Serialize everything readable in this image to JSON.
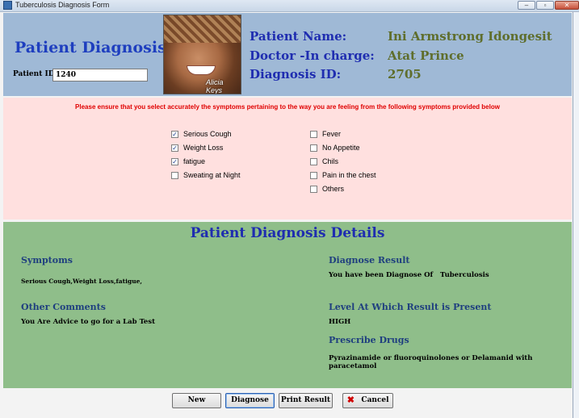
{
  "window": {
    "title": "Tuberculosis Diagnosis Form"
  },
  "header": {
    "title": "Patient Diagnosis",
    "patient_id_label": "Patient ID",
    "patient_id_value": "1240",
    "photo_caption": "Alicia Keys",
    "patient_name_label": "Patient Name:",
    "patient_name_value": "Ini Armstrong Idongesit",
    "doctor_label": "Doctor -In charge:",
    "doctor_value": "Atat Prince",
    "diagnosis_id_label": "Diagnosis ID:",
    "diagnosis_id_value": "2705"
  },
  "symptoms": {
    "instruction": "Please ensure that you select accurately the symptoms pertaining to the way you are feeling from the following symptoms provided below",
    "left": [
      {
        "label": "Serious Cough",
        "checked": true
      },
      {
        "label": "Weight Loss",
        "checked": true
      },
      {
        "label": "fatigue",
        "checked": true
      },
      {
        "label": "Sweating at Night",
        "checked": false
      }
    ],
    "right": [
      {
        "label": "Fever",
        "checked": false
      },
      {
        "label": "No Appetite",
        "checked": false
      },
      {
        "label": "Chils",
        "checked": false
      },
      {
        "label": "Pain in the chest",
        "checked": false
      },
      {
        "label": "Others",
        "checked": false
      }
    ]
  },
  "details": {
    "title": "Patient Diagnosis Details",
    "symptoms_heading": "Symptoms",
    "symptoms_value": "Serious Cough,Weight Loss,fatigue,",
    "comments_heading": "Other Comments",
    "comments_value": "You Are Advice to go for a Lab Test",
    "result_heading": "Diagnose Result",
    "result_value": "You have been Diagnose Of   Tuberculosis",
    "level_heading": "Level At Which Result is Present",
    "level_value": "HIGH",
    "drugs_heading": "Prescribe Drugs",
    "drugs_value": "Pyrazinamide or fluoroquinolones or Delamanid with paracetamol"
  },
  "buttons": {
    "new": "New",
    "diagnose": "Diagnose",
    "print": "Print Result",
    "cancel": "Cancel"
  },
  "colors": {
    "header_bg": "#9fb9d6",
    "symptoms_bg": "#ffe0df",
    "details_bg": "#8fbe8a",
    "title_blue": "#1f2db0",
    "value_olive": "#5f6e2c",
    "instruction_red": "#e00000"
  }
}
